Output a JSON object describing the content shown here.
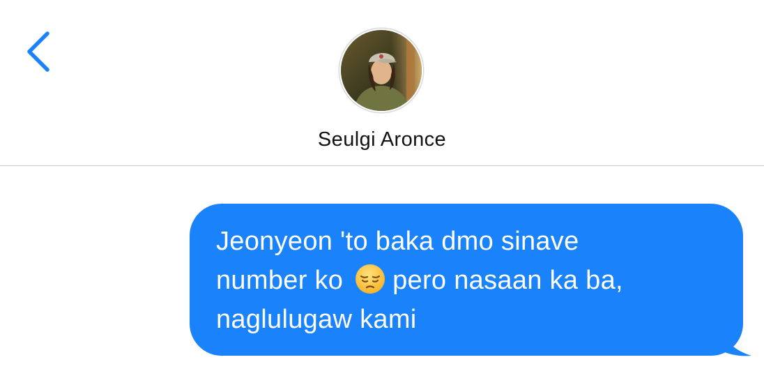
{
  "header": {
    "back_icon": "chevron-left-icon",
    "contact_name": "Seulgi Aronce",
    "avatar_icon": "contact-avatar-photo"
  },
  "colors": {
    "accent": "#1a83fb",
    "bubble_text": "#ffffff",
    "divider": "#c8c8cc"
  },
  "thread": {
    "messages": [
      {
        "direction": "outgoing",
        "line1": "Jeonyeon 'to baka dmo sinave",
        "line2_before": "number ko",
        "emoji": "pensive-face-emoji",
        "line2_after": "pero nasaan ka ba,",
        "line3": "naglulugaw kami"
      }
    ]
  }
}
